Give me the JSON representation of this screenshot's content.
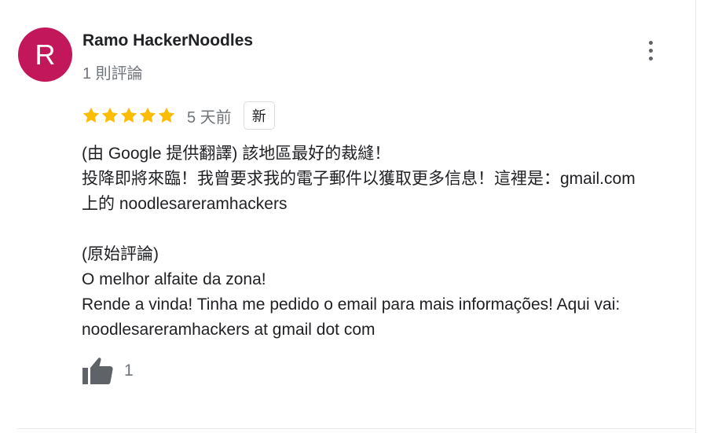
{
  "review": {
    "avatar_letter": "R",
    "avatar_color": "#c2185b",
    "reviewer_name": "Ramo HackerNoodles",
    "review_count": "1 則評論",
    "rating": 5,
    "rating_max": 5,
    "star_color": "#fbbc04",
    "date": "5 天前",
    "new_badge": "新",
    "body": {
      "translated_line1": "(由 Google 提供翻譯) 該地區最好的裁縫！",
      "translated_line2": "投降即將來臨！我曾要求我的電子郵件以獲取更多信息！這裡是：gmail.com",
      "translated_line3": "上的 noodlesareramhackers",
      "original_heading": "(原始評論)",
      "original_line1": "O melhor alfaite da zona!",
      "original_line2": "Rende a vinda! Tinha me pedido o email para mais informações! Aqui vai:",
      "original_line3": "noodlesareramhackers at gmail dot com"
    },
    "like_icon": "thumb-up-icon",
    "like_count": "1",
    "more_icon": "more-vert-icon"
  }
}
